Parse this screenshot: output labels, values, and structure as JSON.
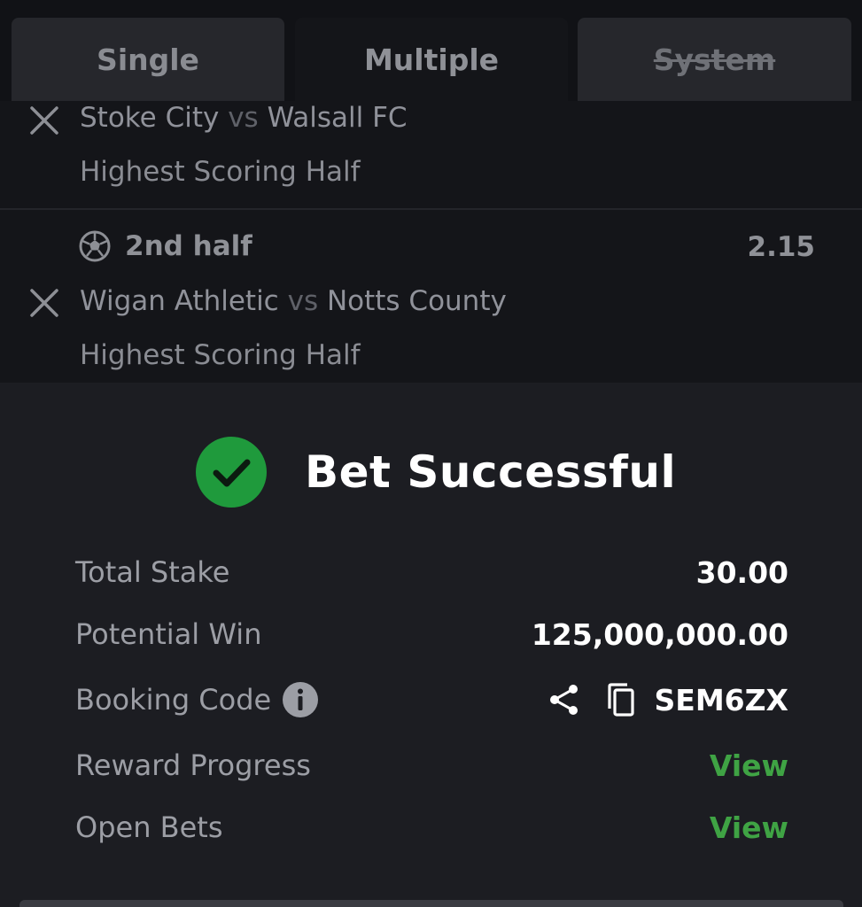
{
  "tabs": {
    "single": "Single",
    "multiple": "Multiple",
    "system": "System"
  },
  "bets": [
    {
      "home": "Stoke City",
      "vs": "vs",
      "away": "Walsall FC",
      "market": "Highest Scoring Half"
    },
    {
      "selection": "2nd half",
      "odds": "2.15",
      "home": "Wigan Athletic",
      "vs": "vs",
      "away": "Notts County",
      "market": "Highest Scoring Half"
    }
  ],
  "success": {
    "title": "Bet Successful",
    "rows": {
      "total_stake_label": "Total Stake",
      "total_stake_value": "30.00",
      "potential_win_label": "Potential Win",
      "potential_win_value": "125,000,000.00",
      "booking_code_label": "Booking Code",
      "booking_code_value": "SEM6ZX",
      "reward_progress_label": "Reward Progress",
      "reward_progress_link": "View",
      "open_bets_label": "Open Bets",
      "open_bets_link": "View"
    }
  },
  "colors": {
    "accent_green": "#3fa344",
    "check_green": "#1f9a3c",
    "panel_bg": "#1c1d22",
    "list_bg": "#141519"
  },
  "icons": [
    "close-icon",
    "soccer-ball-icon",
    "check-circle-icon",
    "info-icon",
    "share-icon",
    "copy-icon"
  ]
}
